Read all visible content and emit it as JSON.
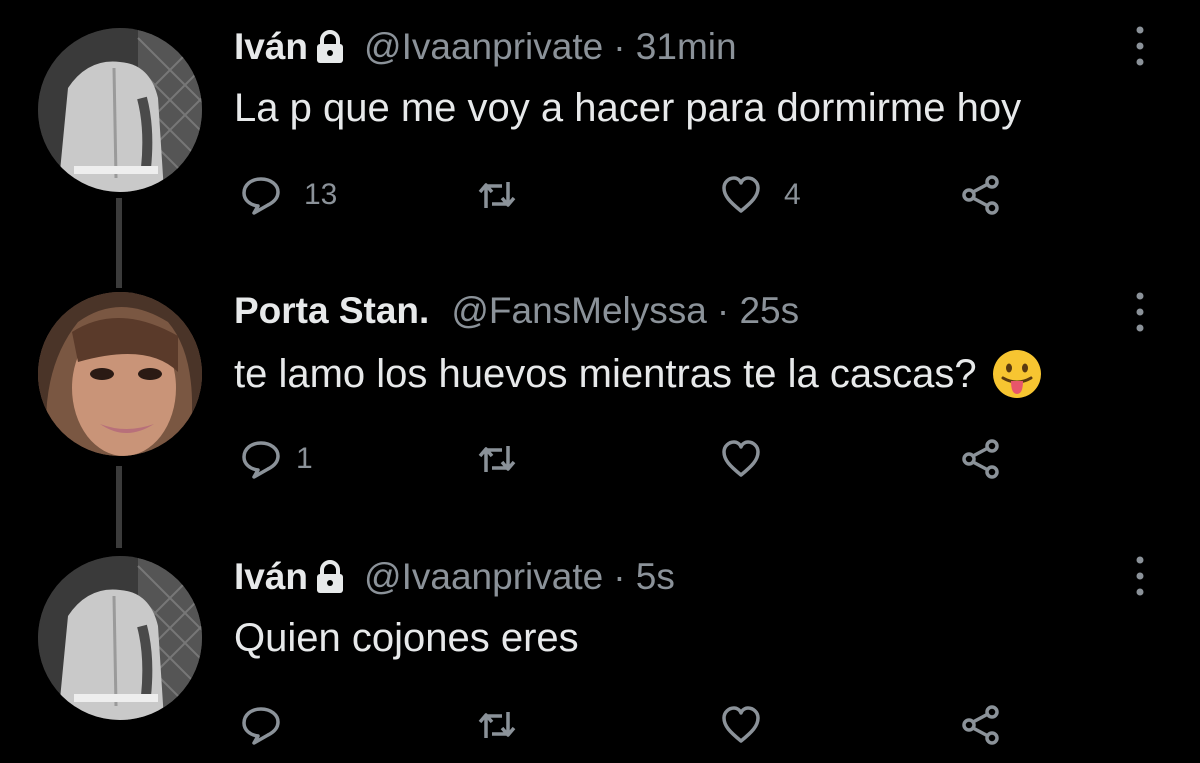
{
  "tweets": [
    {
      "name": "Iván",
      "protected": true,
      "handle": "@Ivaanprivate",
      "time": "· 31min",
      "text": "La p que me voy a hacer para dormirme hoy",
      "emoji": "",
      "replies": "13",
      "retweets": "",
      "likes": "4"
    },
    {
      "name": "Porta Stan.",
      "protected": false,
      "handle": "@FansMelyssa",
      "time": "· 25s",
      "text": "te lamo los huevos mientras te la cascas?",
      "emoji": "face-with-tongue-emoji",
      "replies": "1",
      "retweets": "",
      "likes": ""
    },
    {
      "name": "Iván",
      "protected": true,
      "handle": "@Ivaanprivate",
      "time": "· 5s",
      "text": "Quien cojones eres",
      "emoji": "",
      "replies": "",
      "retweets": "",
      "likes": ""
    }
  ],
  "icons": {
    "reply": "reply-icon",
    "retweet": "retweet-icon",
    "like": "heart-icon",
    "share": "share-icon",
    "more": "more-options-icon",
    "lock": "lock-icon"
  },
  "colors": {
    "background": "#000000",
    "primary_text": "#e7e9ea",
    "secondary_text": "#8b9299",
    "thread_line": "#3b3b3b"
  }
}
